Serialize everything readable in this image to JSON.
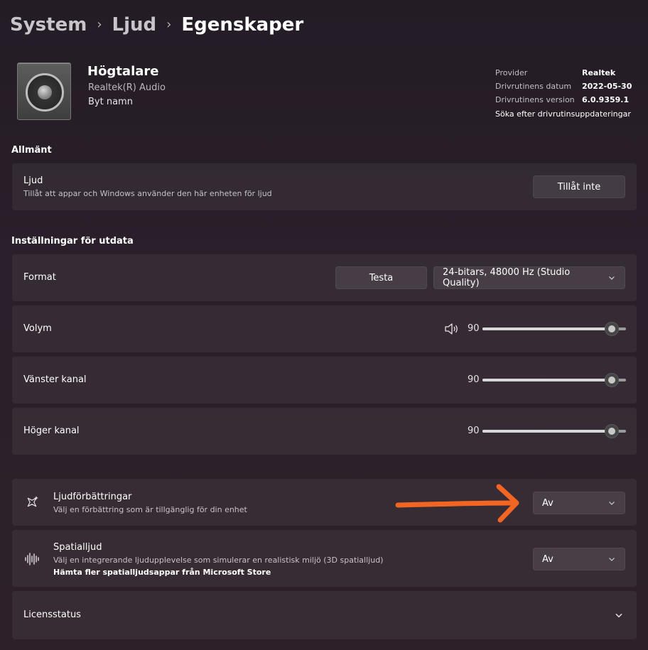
{
  "breadcrumb": {
    "item1": "System",
    "item2": "Ljud",
    "current": "Egenskaper"
  },
  "device": {
    "name": "Högtalare",
    "manufacturer": "Realtek(R) Audio",
    "rename": "Byt namn",
    "icon": "speaker-device-icon"
  },
  "driver": {
    "provider_label": "Provider",
    "provider_value": "Realtek",
    "date_label": "Drivrutinens datum",
    "date_value": "2022-05-30",
    "version_label": "Drivrutinens version",
    "version_value": "6.0.9359.1",
    "update_link": "Söka efter drivrutinsuppdateringar"
  },
  "general": {
    "title": "Allmänt",
    "audio_title": "Ljud",
    "audio_desc": "Tillåt att appar och Windows använder den här enheten för ljud",
    "audio_button": "Tillåt inte"
  },
  "output": {
    "title": "Inställningar för utdata",
    "format_label": "Format",
    "test_button": "Testa",
    "format_value": "24-bitars, 48000 Hz (Studio Quality)",
    "volume_label": "Volym",
    "volume_value": "90",
    "volume_level": 90,
    "left_label": "Vänster kanal",
    "left_value": "90",
    "left_level": 90,
    "right_label": "Höger kanal",
    "right_value": "90",
    "right_level": 90
  },
  "enhancements": {
    "title": "Ljudförbättringar",
    "desc": "Välj en förbättring som är tillgänglig för din enhet",
    "value": "Av"
  },
  "spatial": {
    "title": "Spatialljud",
    "desc": "Välj en integrerande ljudupplevelse som simulerar en realistisk miljö (3D spatialljud)",
    "link": "Hämta fler spatialljudsappar från Microsoft Store",
    "value": "Av"
  },
  "license": {
    "title": "Licensstatus"
  },
  "colors": {
    "annotation_arrow": "#f26522",
    "slider_fill": "#d8d8d8"
  }
}
